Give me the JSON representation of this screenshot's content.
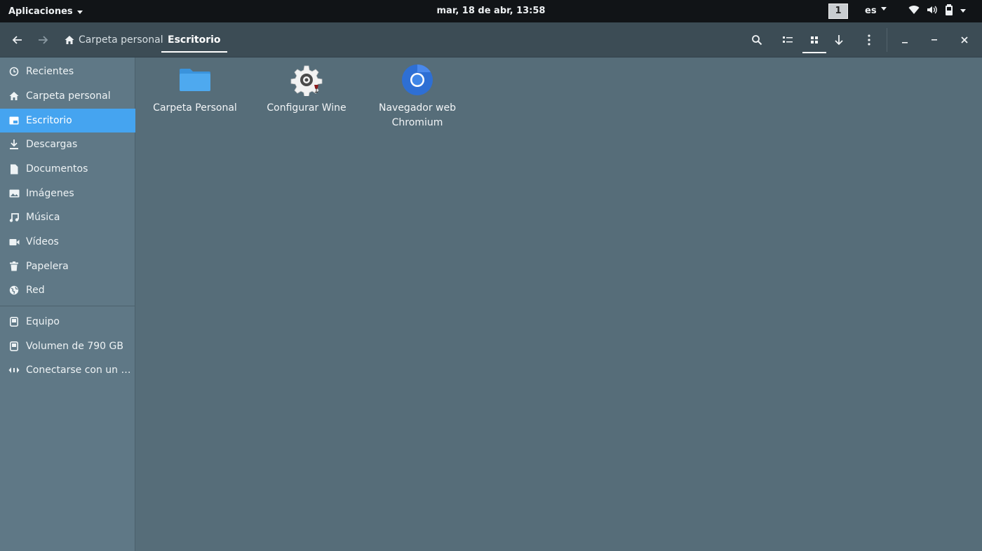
{
  "top_panel": {
    "apps_label": "Aplicaciones",
    "clock": "mar, 18 de abr, 13:58",
    "workspace": "1",
    "language": "es",
    "tray_icons": [
      "network-wireless-icon",
      "volume-icon",
      "battery-icon",
      "chevron-down-icon"
    ]
  },
  "headerbar": {
    "breadcrumb_home": "Carpeta personal",
    "breadcrumb_current": "Escritorio",
    "icons": [
      "arrow-back-icon",
      "arrow-forward-icon",
      "search-icon",
      "list-view-icon",
      "grid-view-icon",
      "sort-arrow-down-icon",
      "kebab-menu-icon",
      "minimize-icon",
      "maximize-icon",
      "close-icon"
    ]
  },
  "sidebar": {
    "items": [
      {
        "label": "Recientes",
        "icon": "clock-icon"
      },
      {
        "label": "Carpeta personal",
        "icon": "home-icon"
      },
      {
        "label": "Escritorio",
        "icon": "desktop-icon",
        "active": true
      },
      {
        "label": "Descargas",
        "icon": "download-icon"
      },
      {
        "label": "Documentos",
        "icon": "document-icon"
      },
      {
        "label": "Imágenes",
        "icon": "image-icon"
      },
      {
        "label": "Música",
        "icon": "music-icon"
      },
      {
        "label": "Vídeos",
        "icon": "video-icon"
      },
      {
        "label": "Papelera",
        "icon": "trash-icon"
      },
      {
        "label": "Red",
        "icon": "network-icon"
      }
    ],
    "devices": [
      {
        "label": "Equipo",
        "icon": "drive-icon"
      },
      {
        "label": "Volumen de 790 GB",
        "icon": "drive-icon"
      },
      {
        "label": "Conectarse con un …",
        "icon": "connect-server-icon"
      }
    ]
  },
  "files": [
    {
      "label": "Carpeta Personal",
      "icon": "folder-icon"
    },
    {
      "label": "Configurar Wine",
      "icon": "wine-config-icon"
    },
    {
      "label": "Navegador web Chromium",
      "icon": "chromium-icon"
    }
  ],
  "colors": {
    "accent": "#45a4f0",
    "sidebar_bg": "#5f7886",
    "content_bg": "#566d79",
    "headerbar_bg": "#3c4c55",
    "panel_bg": "#111417"
  }
}
